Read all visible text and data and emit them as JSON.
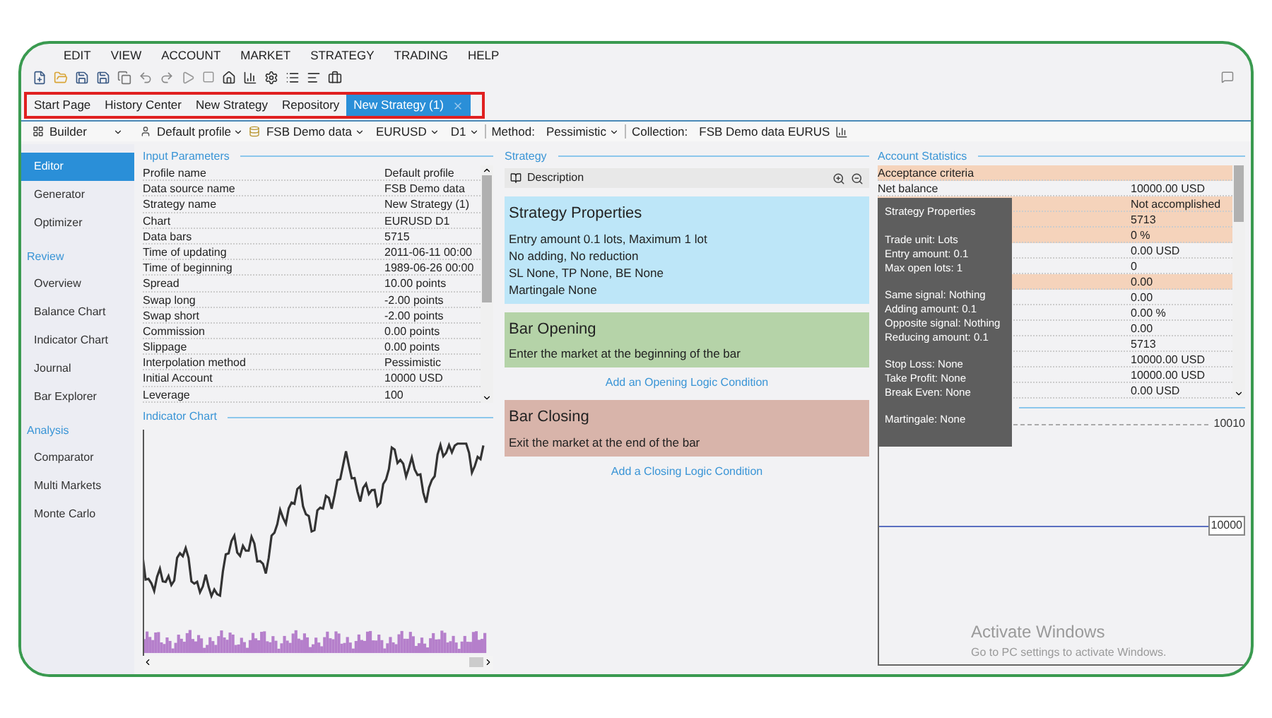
{
  "menu": [
    "EDIT",
    "VIEW",
    "ACCOUNT",
    "MARKET",
    "STRATEGY",
    "TRADING",
    "HELP"
  ],
  "tabs": [
    {
      "label": "Start Page",
      "selected": false
    },
    {
      "label": "History Center",
      "selected": false
    },
    {
      "label": "New Strategy",
      "selected": false
    },
    {
      "label": "Repository",
      "selected": false
    },
    {
      "label": "New Strategy (1)",
      "selected": true
    }
  ],
  "toolbar": {
    "mode": "Builder",
    "profile": "Default profile",
    "data_source": "FSB Demo data",
    "symbol": "EURUSD",
    "period": "D1",
    "method_label": "Method:",
    "method": "Pessimistic",
    "collection_label": "Collection:",
    "collection": "FSB Demo data EURUS"
  },
  "sidebar": [
    {
      "items": [
        {
          "label": "Editor",
          "selected": true
        },
        {
          "label": "Generator",
          "selected": false
        },
        {
          "label": "Optimizer",
          "selected": false
        }
      ]
    },
    {
      "title": "Review",
      "items": [
        {
          "label": "Overview",
          "selected": false
        },
        {
          "label": "Balance Chart",
          "selected": false
        },
        {
          "label": "Indicator Chart",
          "selected": false
        },
        {
          "label": "Journal",
          "selected": false
        },
        {
          "label": "Bar Explorer",
          "selected": false
        }
      ]
    },
    {
      "title": "Analysis",
      "items": [
        {
          "label": "Comparator",
          "selected": false
        },
        {
          "label": "Multi Markets",
          "selected": false
        },
        {
          "label": "Monte Carlo",
          "selected": false
        }
      ]
    }
  ],
  "input_parameters": {
    "title": "Input Parameters",
    "rows": [
      {
        "label": "Profile name",
        "value": "Default profile"
      },
      {
        "label": "Data source name",
        "value": "FSB Demo data"
      },
      {
        "label": "Strategy name",
        "value": "New Strategy (1)"
      },
      {
        "label": "Chart",
        "value": "EURUSD D1"
      },
      {
        "label": "Data bars",
        "value": "5715"
      },
      {
        "label": "Time of updating",
        "value": "2011-06-11 00:00"
      },
      {
        "label": "Time of beginning",
        "value": "1989-06-26 00:00"
      },
      {
        "label": "Spread",
        "value": "10.00 points"
      },
      {
        "label": "Swap long",
        "value": "-2.00 points"
      },
      {
        "label": "Swap short",
        "value": "-2.00 points"
      },
      {
        "label": "Commission",
        "value": "0.00 points"
      },
      {
        "label": "Slippage",
        "value": "0.00 points"
      },
      {
        "label": "Interpolation method",
        "value": "Pessimistic"
      },
      {
        "label": "Initial Account",
        "value": "10000 USD"
      },
      {
        "label": "Leverage",
        "value": "100"
      }
    ]
  },
  "indicator_chart": {
    "title": "Indicator Chart"
  },
  "strategy": {
    "title": "Strategy",
    "description_button": "Description",
    "blocks": [
      {
        "kind": "properties",
        "title": "Strategy Properties",
        "lines": [
          "Entry amount 0.1 lots, Maximum 1 lot",
          "No adding, No reduction",
          "SL None,  TP None,  BE None",
          "Martingale None"
        ]
      },
      {
        "kind": "opening",
        "title": "Bar Opening",
        "lines": [
          "Enter the market at the beginning of the bar"
        ],
        "link": "Add an Opening Logic Condition"
      },
      {
        "kind": "closing",
        "title": "Bar Closing",
        "lines": [
          "Exit the market at the end of the bar"
        ],
        "link": "Add a Closing Logic Condition"
      }
    ]
  },
  "account_statistics": {
    "title": "Account Statistics",
    "rows": [
      {
        "label": "Acceptance criteria",
        "highlighted": true
      },
      {
        "label": "Net balance",
        "value": "10000.00 USD",
        "highlighted": false
      },
      {
        "value": "Not accomplished",
        "highlighted": true
      },
      {
        "value": "5713",
        "highlighted": true
      },
      {
        "value": "0 %",
        "highlighted": true
      },
      {
        "value": "0.00 USD",
        "highlighted": false
      },
      {
        "value": "0",
        "highlighted": false
      },
      {
        "value": "0.00",
        "highlighted": true
      },
      {
        "value": "0.00",
        "highlighted": false
      },
      {
        "value": "0.00 %",
        "highlighted": false
      },
      {
        "value": "0.00",
        "highlighted": false
      },
      {
        "value": "5713",
        "highlighted": false
      },
      {
        "value": "10000.00 USD",
        "highlighted": false
      },
      {
        "value": "10000.00 USD",
        "highlighted": false
      },
      {
        "value": "0.00 USD",
        "highlighted": false
      }
    ]
  },
  "balance_chart": {
    "labels": [
      "10010",
      "10000"
    ]
  },
  "tooltip": {
    "title": "Strategy Properties",
    "groups": [
      [
        "Trade unit: Lots",
        "Entry amount: 0.1",
        "Max open lots: 1"
      ],
      [
        "Same signal: Nothing",
        "Adding amount: 0.1",
        "Opposite signal: Nothing",
        "Reducing amount: 0.1"
      ],
      [
        "Stop Loss: None",
        "Take Profit: None",
        "Break Even: None"
      ],
      [
        "Martingale: None"
      ]
    ]
  },
  "activation_notice": {
    "title": "Activate Windows",
    "text": "Go to PC settings to activate Windows."
  }
}
